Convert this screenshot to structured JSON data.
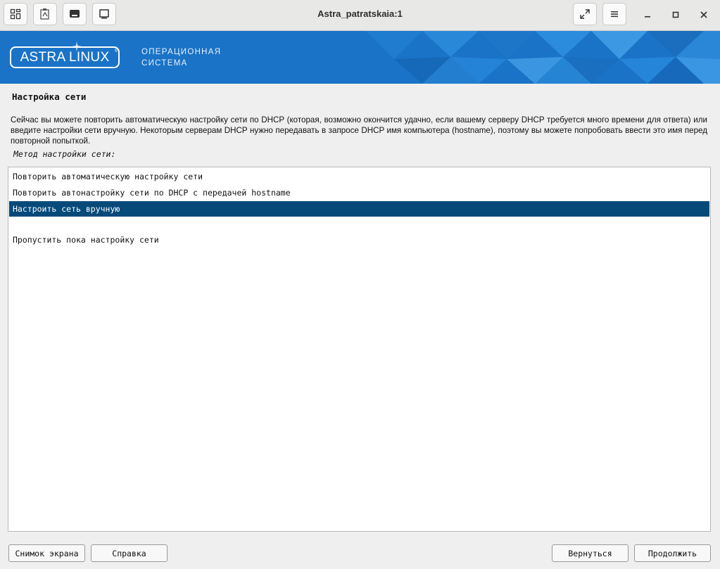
{
  "window": {
    "title": "Astra_patratskaia:1",
    "toolbar_icons": [
      "windows-grid-icon",
      "clipboard-icon",
      "keyboard-icon",
      "display-icon"
    ],
    "right_icons": [
      "fullscreen-icon",
      "menu-icon"
    ],
    "controls": [
      "minimize-icon",
      "maximize-icon",
      "close-icon"
    ]
  },
  "banner": {
    "logo": "ASTRA LINUX",
    "subtitle_line1": "ОПЕРАЦИОННАЯ",
    "subtitle_line2": "СИСТЕМА",
    "color": "#1a73c7"
  },
  "page": {
    "title": "Настройка сети",
    "description": "Сейчас вы можете повторить автоматическую настройку сети по DHCP (которая, возможно окончится удачно, если вашему серверу DHCP требуется много времени для ответа) или введите настройки сети вручную. Некоторым серверам DHCP нужно передавать в запросе DHCP имя компьютера (hostname), поэтому вы можете попробовать ввести это имя перед повторной попыткой.",
    "method_label": "Метод настройки сети:",
    "options": [
      {
        "label": "Повторить автоматическую настройку сети",
        "selected": false
      },
      {
        "label": "Повторить автонастройку сети по DHCP с передачей hostname",
        "selected": false
      },
      {
        "label": "Настроить сеть вручную",
        "selected": true
      },
      {
        "label": "",
        "selected": false
      },
      {
        "label": "Пропустить пока настройку сети",
        "selected": false
      }
    ],
    "selection_color": "#064a7a"
  },
  "buttons": {
    "screenshot": "Снимок экрана",
    "help": "Справка",
    "back": "Вернуться",
    "continue": "Продолжить"
  }
}
